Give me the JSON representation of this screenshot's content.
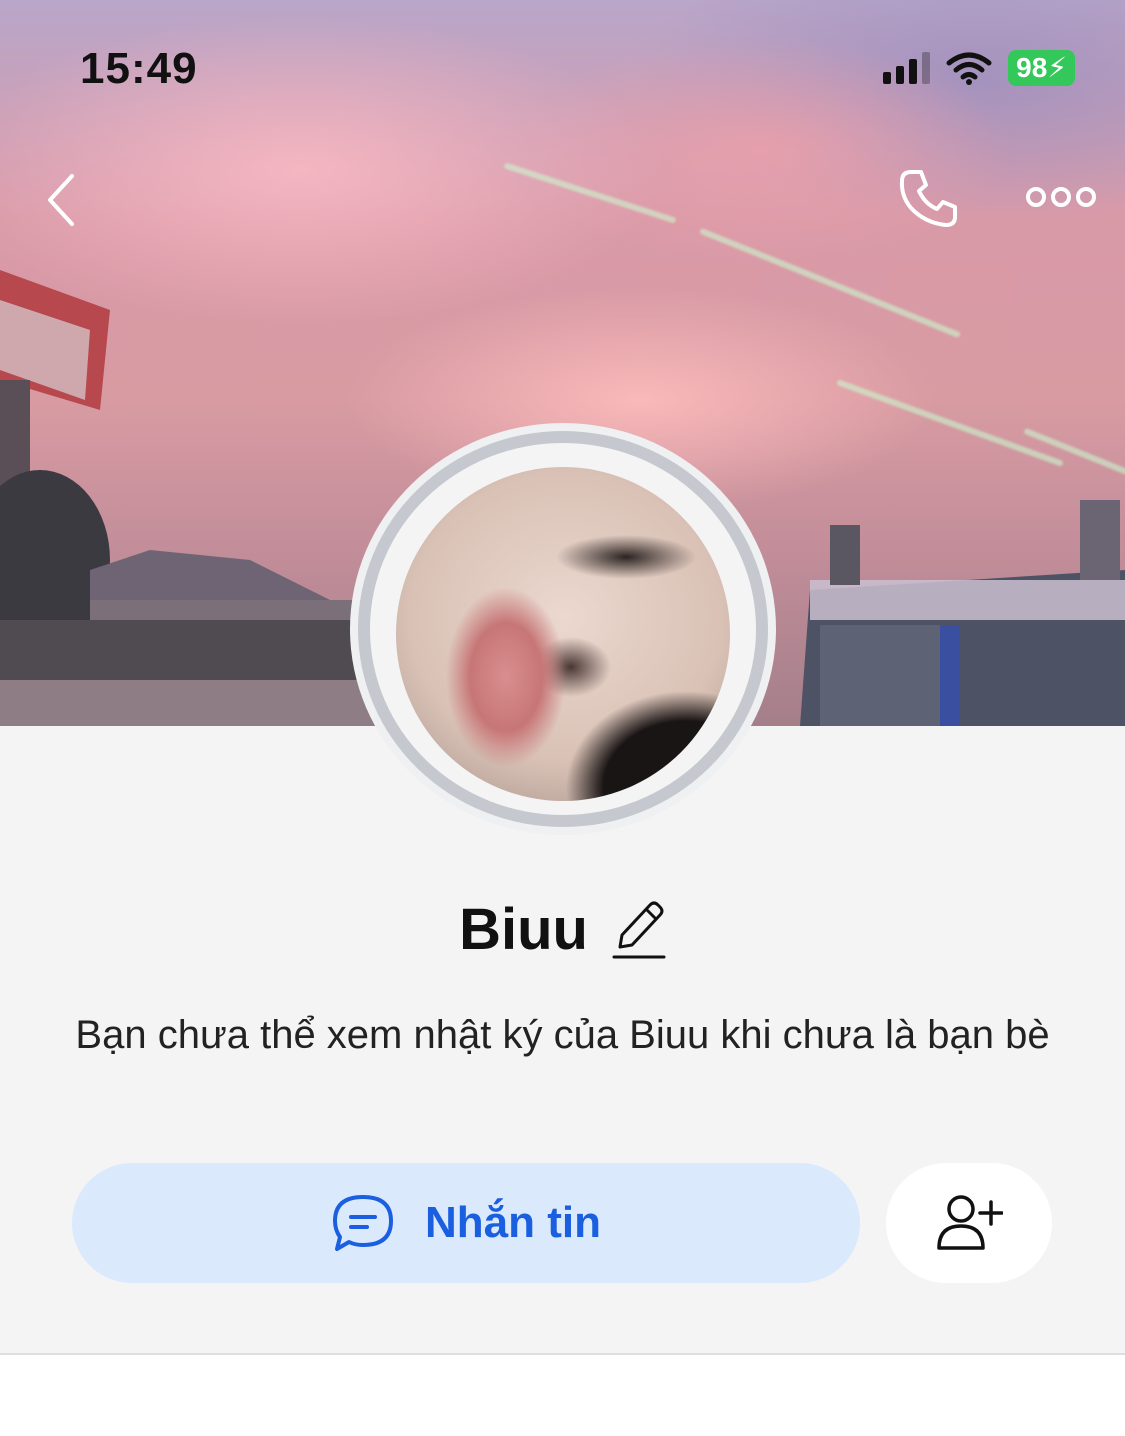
{
  "status_bar": {
    "time": "15:49",
    "battery": "98"
  },
  "profile": {
    "name": "Biuu",
    "info_message": "Bạn chưa thể xem nhật ký của Biuu khi chưa là bạn bè"
  },
  "actions": {
    "message_label": "Nhắn tin"
  },
  "icons": {
    "back": "chevron-left-icon",
    "call": "phone-icon",
    "more": "more-dots-icon",
    "edit": "pencil-icon",
    "message": "chat-bubble-icon",
    "add_friend": "add-user-icon"
  },
  "colors": {
    "accent": "#1a5fe0",
    "message_button_bg": "#dbe9fd",
    "battery": "#34c759"
  }
}
